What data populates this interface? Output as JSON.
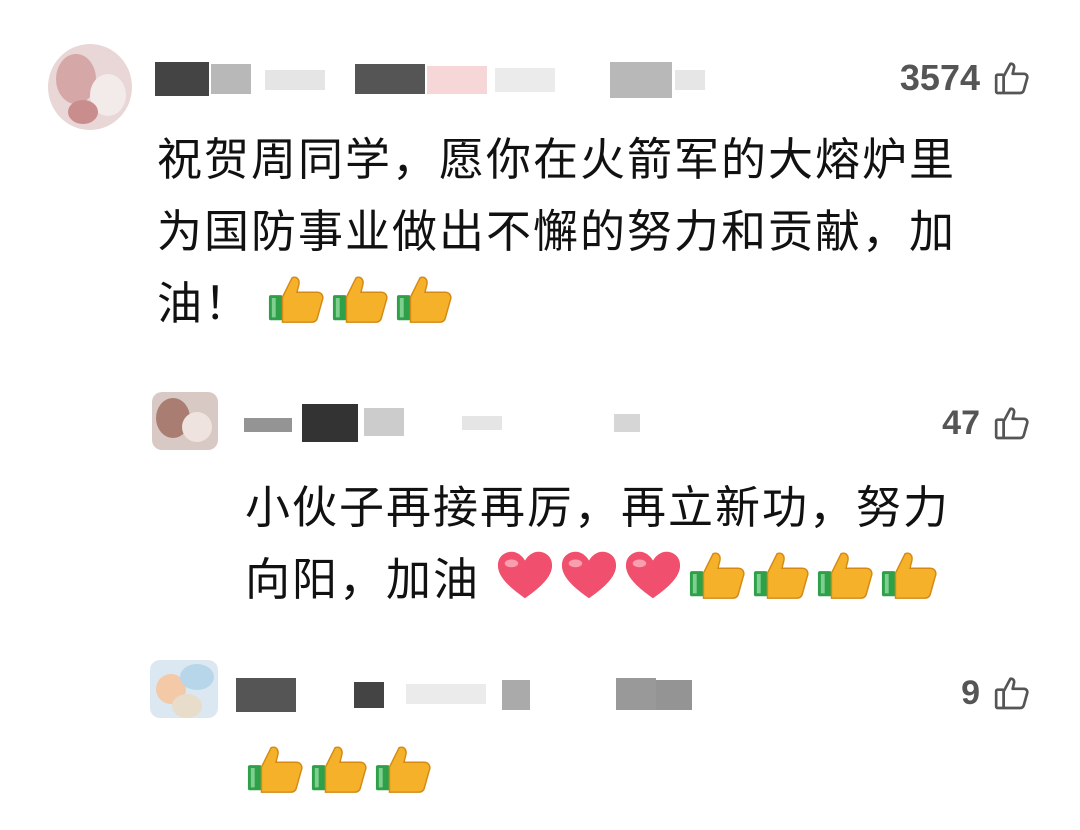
{
  "comments": [
    {
      "likes": "3574",
      "lines": [
        "祝贺周同学，愿你在火箭军的大熔炉里",
        "为国防事业做出不懈的努力和贡献，加",
        "油！"
      ],
      "emojis": [
        "thumbs-up",
        "thumbs-up",
        "thumbs-up"
      ]
    },
    {
      "likes": "47",
      "lines": [
        "小伙子再接再厉，再立新功，努力",
        "向阳，加油"
      ],
      "emojis": [
        "heart",
        "heart",
        "heart",
        "thumbs-up",
        "thumbs-up",
        "thumbs-up",
        "thumbs-up"
      ]
    },
    {
      "likes": "9",
      "lines": [],
      "emojis": [
        "thumbs-up",
        "thumbs-up",
        "thumbs-up"
      ]
    }
  ],
  "icons": {
    "like": "thumbs-up-outline-icon"
  },
  "colors": {
    "text": "#111111",
    "likes": "#555555",
    "heart": "#f0506e",
    "thumb": "#f5b12a",
    "cuff": "#2ea04a"
  }
}
